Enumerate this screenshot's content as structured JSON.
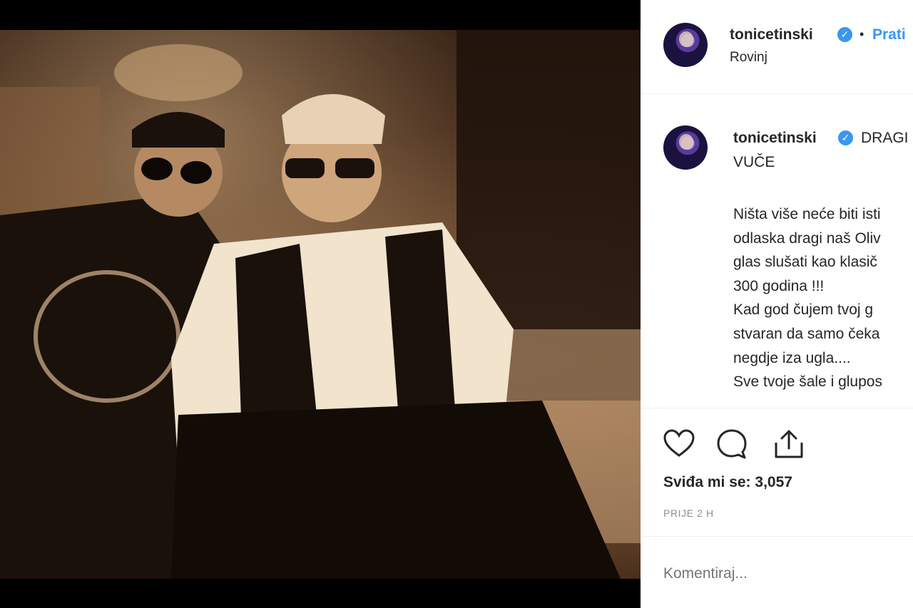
{
  "post": {
    "username": "tonicetinski",
    "follow_label": "Prati",
    "location": "Rovinj"
  },
  "caption": {
    "username": "tonicetinski",
    "title_line1": "DRAGI",
    "title_line2": "VUČE",
    "lines": [
      "Ništa više neće biti isti",
      "odlaska dragi naš Oliv",
      "glas slušati kao klasič",
      "300 godina !!!",
      "Kad god čujem tvoj g",
      "stvaran da samo čeka",
      "negdje iza ugla....",
      "Sve tvoje šale i glupos"
    ]
  },
  "actions": {
    "like_icon": "heart-icon",
    "comment_icon": "comment-icon",
    "share_icon": "share-icon",
    "likes_text": "Sviđa mi se: 3,057",
    "time_text": "PRIJE 2 H"
  },
  "comment": {
    "placeholder": "Komentiraj..."
  },
  "colors": {
    "accent": "#3897f0",
    "text": "#262626",
    "muted": "#8e8e8e"
  }
}
